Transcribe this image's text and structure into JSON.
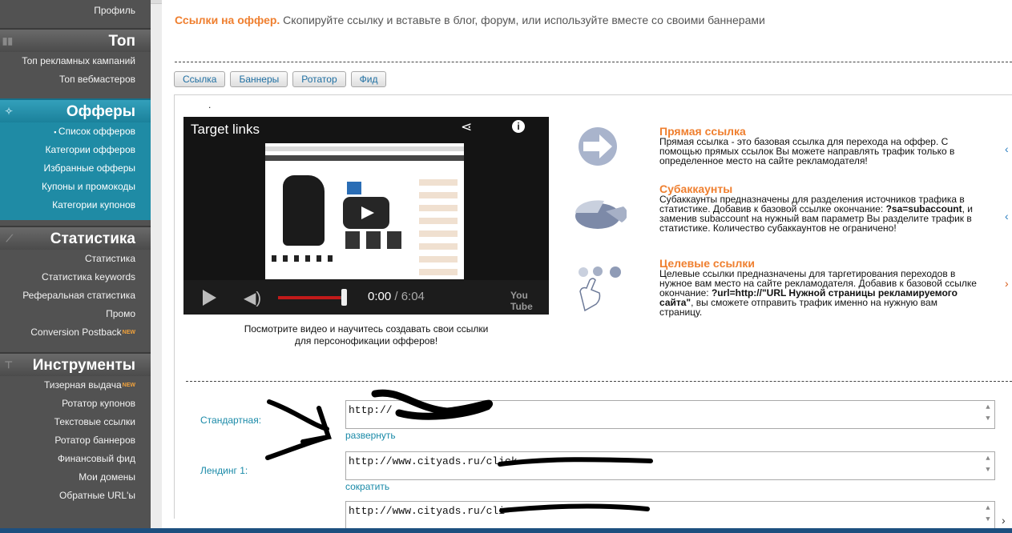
{
  "sidebar": {
    "profile": "Профиль",
    "top": {
      "title": "Топ",
      "items": [
        "Топ рекламных кампаний",
        "Топ вебмастеров"
      ]
    },
    "offers": {
      "title": "Офферы",
      "items": [
        "Список офферов",
        "Категории офферов",
        "Избранные офферы",
        "Купоны и промокоды",
        "Категории купонов"
      ]
    },
    "stats": {
      "title": "Статистика",
      "items": [
        "Статистика",
        "Статистика keywords",
        "Реферальная статистика",
        "Промо",
        "Conversion Postback"
      ]
    },
    "tools": {
      "title": "Инструменты",
      "items": [
        "Тизерная выдача",
        "Ротатор купонов",
        "Текстовые ссылки",
        "Ротатор баннеров",
        "Финансовый фид",
        "Мои домены",
        "Обратные URL'ы"
      ]
    },
    "new_badge": "NEW"
  },
  "intro": {
    "accent": "Ссылки на оффер.",
    "text": " Скопируйте ссылку и вставьте в блог, форум, или используйте вместе со своими баннерами"
  },
  "tabs": [
    "Ссылка",
    "Баннеры",
    "Ротатор",
    "Фид"
  ],
  "video": {
    "title": "Target links",
    "time_current": "0:00",
    "time_total": "/ 6:04",
    "progress": 0.0,
    "volume": 0.95,
    "logo": "You Tube",
    "caption": "Посмотрите видео и научитесь создавать свои ссылки для персонофикации офферов!",
    "dot": "."
  },
  "features": [
    {
      "title": "Прямая ссылка",
      "text": "Прямая ссылка - это базовая ссылка для перехода на оффер. С помощью прямых ссылок Вы можете направлять трафик только в определенное место на сайте рекламодателя!",
      "icon": "arrow-right-icon"
    },
    {
      "title": "Субаккаунты",
      "text_before": "Субаккаунты предназначены для разделения источников трафика в статистике. Добавив к базовой ссылке окончание: ",
      "bold": "?sa=subaccount",
      "text_after": ", и заменив subaccount на нужный вам параметр Вы разделите трафик в статистике. Количество субаккаунтов не ограничено!",
      "icon": "pie-chart-icon"
    },
    {
      "title": "Целевые ссылки",
      "text_before": "Целевые ссылки предназначены для таргетирования переходов в нужное вам место на сайте рекламодателя. Добавив к базовой ссылке окончание: ",
      "bold": "?url=http://\"URL Нужной страницы рекламируемого сайта\"",
      "text_after": ", вы сможете отправить трафик именно на нужную вам страницу.",
      "icon": "pointing-hand-icon"
    }
  ],
  "links": [
    {
      "label": "Стандартная:",
      "value": "http://",
      "toggle": "развернуть"
    },
    {
      "label": "Лендинг 1:",
      "value": "http://www.cityads.ru/click-",
      "toggle": "сократить"
    },
    {
      "label": "",
      "value": "http://www.cityads.ru/cli",
      "toggle": ""
    }
  ]
}
